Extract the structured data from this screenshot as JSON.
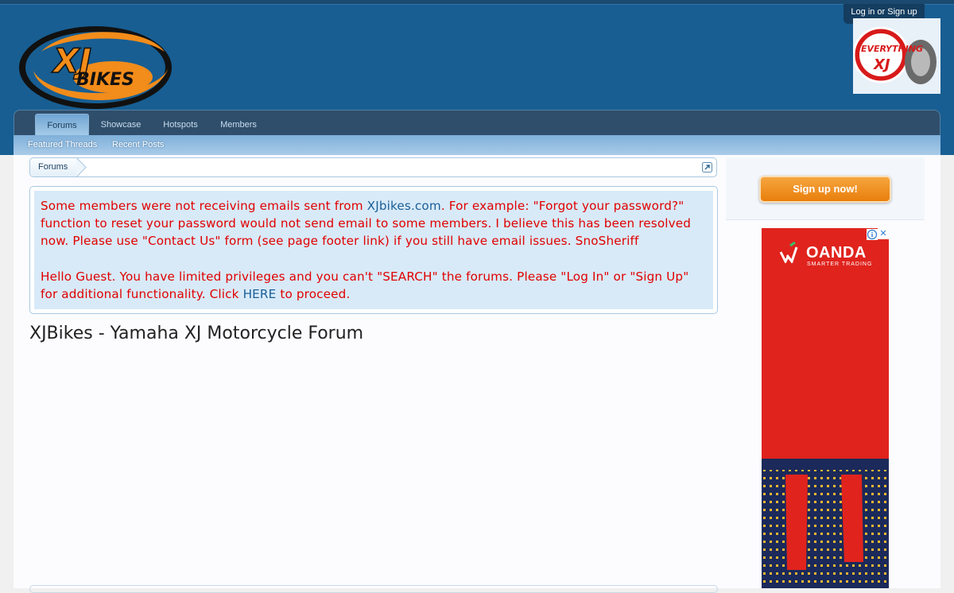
{
  "header": {
    "logo_text_top": "XJ",
    "logo_text_bottom": "BIKES",
    "login_label": "Log in or Sign up",
    "badge_text_top": "EVERYTHING",
    "badge_text_bottom": "XJ"
  },
  "nav": {
    "tabs": [
      {
        "label": "Forums",
        "active": true
      },
      {
        "label": "Showcase",
        "active": false
      },
      {
        "label": "Hotspots",
        "active": false
      },
      {
        "label": "Members",
        "active": false
      }
    ],
    "subtabs": [
      {
        "label": "Featured Threads"
      },
      {
        "label": "Recent Posts"
      }
    ]
  },
  "breadcrumb": {
    "items": [
      "Forums"
    ]
  },
  "notice": {
    "p1_before": "Some members were not receiving emails sent from ",
    "p1_link": "XJbikes.com",
    "p1_after": ". For example: \"Forgot your password?\" function to reset your password would not send email to some members. I believe this has been resolved now. Please use \"Contact Us\" form (see page footer link) if you still have email issues. SnoSheriff",
    "p2_before": "Hello Guest. You have limited privileges and you can't \"SEARCH\" the forums. Please \"Log In\" or \"Sign Up\" for additional functionality. Click ",
    "p2_link": "HERE",
    "p2_after": " to proceed."
  },
  "page": {
    "title": "XJBikes - Yamaha XJ Motorcycle Forum"
  },
  "sidebar": {
    "signup_label": "Sign up now!"
  },
  "ad": {
    "brand": "OANDA",
    "tagline": "SMARTER TRADING",
    "close_label": "✕"
  },
  "colors": {
    "header_bg": "#185e92",
    "nav_bg": "#2e4e6b",
    "notice_text": "#e10000",
    "notice_bg": "#d8eaf8",
    "signup_orange": "#e87f0c",
    "ad_red": "#e0231d"
  }
}
